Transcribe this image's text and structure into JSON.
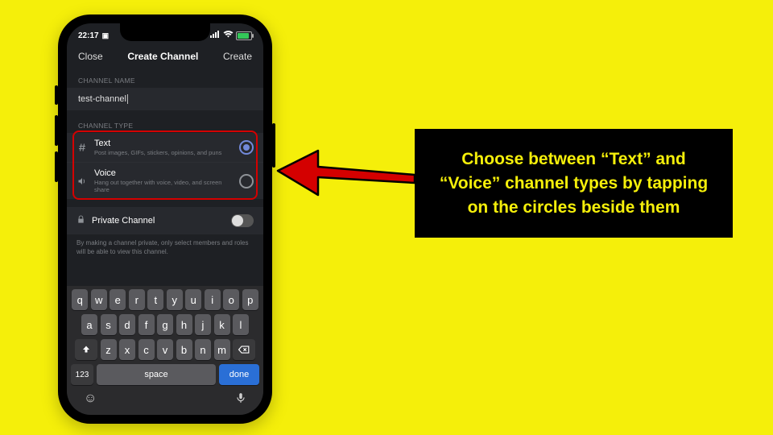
{
  "status": {
    "time": "22:17",
    "camera_icon": "camera-indicator"
  },
  "nav": {
    "close": "Close",
    "title": "Create Channel",
    "create": "Create"
  },
  "form": {
    "name_label": "CHANNEL NAME",
    "name_value": "test-channel",
    "type_label": "CHANNEL TYPE",
    "types": [
      {
        "title": "Text",
        "subtitle": "Post images, GIFs, stickers, opinions, and puns",
        "selected": true
      },
      {
        "title": "Voice",
        "subtitle": "Hang out together with voice, video, and screen share",
        "selected": false
      }
    ],
    "private_title": "Private Channel",
    "private_desc": "By making a channel private, only select members and roles will be able to view this channel."
  },
  "keyboard": {
    "row1": [
      "q",
      "w",
      "e",
      "r",
      "t",
      "y",
      "u",
      "i",
      "o",
      "p"
    ],
    "row2": [
      "a",
      "s",
      "d",
      "f",
      "g",
      "h",
      "j",
      "k",
      "l"
    ],
    "row3": [
      "z",
      "x",
      "c",
      "v",
      "b",
      "n",
      "m"
    ],
    "fn": "123",
    "space": "space",
    "done": "done"
  },
  "callout": "Choose between “Text” and “Voice” channel types by tapping on the circles beside them"
}
